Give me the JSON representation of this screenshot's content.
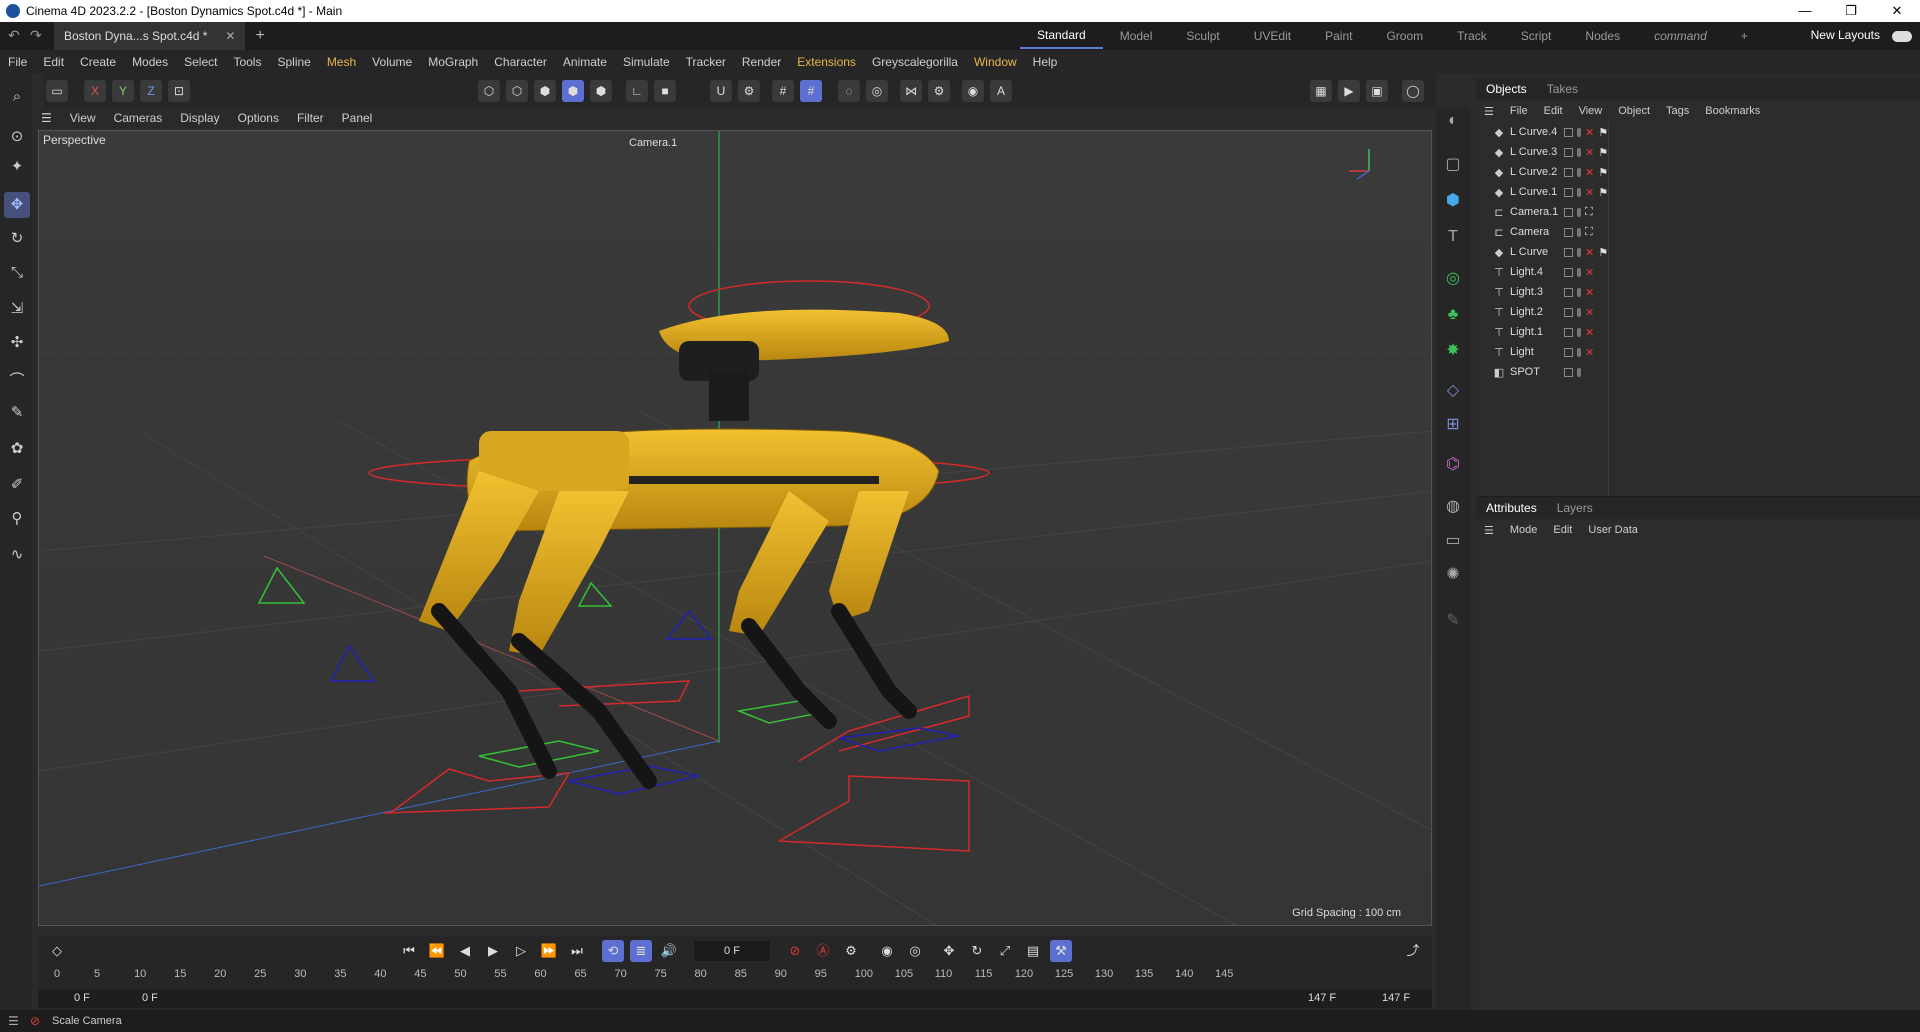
{
  "window": {
    "title": "Cinema 4D 2023.2.2 - [Boston Dynamics Spot.c4d *] - Main",
    "minimize": "—",
    "maximize": "❐",
    "close": "✕"
  },
  "tabs": {
    "doc_tab": "Boston Dyna...s Spot.c4d *",
    "layouts": [
      "Standard",
      "Model",
      "Sculpt",
      "UVEdit",
      "Paint",
      "Groom",
      "Track",
      "Script",
      "Nodes",
      "command"
    ],
    "active_layout": "Standard",
    "new_layouts": "New Layouts"
  },
  "menu": [
    "File",
    "Edit",
    "Create",
    "Modes",
    "Select",
    "Tools",
    "Spline",
    "Mesh",
    "Volume",
    "MoGraph",
    "Character",
    "Animate",
    "Simulate",
    "Tracker",
    "Render",
    "Extensions",
    "Greyscalegorilla",
    "Window",
    "Help"
  ],
  "axis_lock": {
    "x": "X",
    "y": "Y",
    "z": "Z"
  },
  "viewport": {
    "menu": [
      "View",
      "Cameras",
      "Display",
      "Options",
      "Filter",
      "Panel"
    ],
    "label": "Perspective",
    "camera": "Camera.1",
    "grid_spacing": "Grid Spacing : 100 cm"
  },
  "objects_panel": {
    "tabs": [
      "Objects",
      "Takes"
    ],
    "menu": [
      "File",
      "Edit",
      "View",
      "Object",
      "Tags",
      "Bookmarks"
    ],
    "items": [
      {
        "name": "L Curve.4",
        "icon": "spline-icon"
      },
      {
        "name": "L Curve.3",
        "icon": "spline-icon"
      },
      {
        "name": "L Curve.2",
        "icon": "spline-icon"
      },
      {
        "name": "L Curve.1",
        "icon": "spline-icon"
      },
      {
        "name": "Camera.1",
        "icon": "camera-icon"
      },
      {
        "name": "Camera",
        "icon": "camera-icon"
      },
      {
        "name": "L Curve",
        "icon": "spline-icon"
      },
      {
        "name": "Light.4",
        "icon": "light-icon"
      },
      {
        "name": "Light.3",
        "icon": "light-icon"
      },
      {
        "name": "Light.2",
        "icon": "light-icon"
      },
      {
        "name": "Light.1",
        "icon": "light-icon"
      },
      {
        "name": "Light",
        "icon": "light-icon"
      },
      {
        "name": "SPOT",
        "icon": "null-icon"
      }
    ]
  },
  "attributes_panel": {
    "tabs": [
      "Attributes",
      "Layers"
    ],
    "menu": [
      "Mode",
      "Edit",
      "User Data"
    ]
  },
  "timeline": {
    "current_frame": "0 F",
    "ticks": [
      "0",
      "5",
      "10",
      "15",
      "20",
      "25",
      "30",
      "35",
      "40",
      "45",
      "50",
      "55",
      "60",
      "65",
      "70",
      "75",
      "80",
      "85",
      "90",
      "95",
      "100",
      "105",
      "110",
      "115",
      "120",
      "125",
      "130",
      "135",
      "140",
      "145"
    ],
    "range_start": "0 F",
    "range_start2": "0 F",
    "range_end": "147 F",
    "range_end2": "147 F"
  },
  "status": {
    "text": "Scale Camera"
  },
  "colors": {
    "accent": "#5d6fd0",
    "robot_yellow": "#e0a81c",
    "spline_red": "#d42a2a"
  }
}
